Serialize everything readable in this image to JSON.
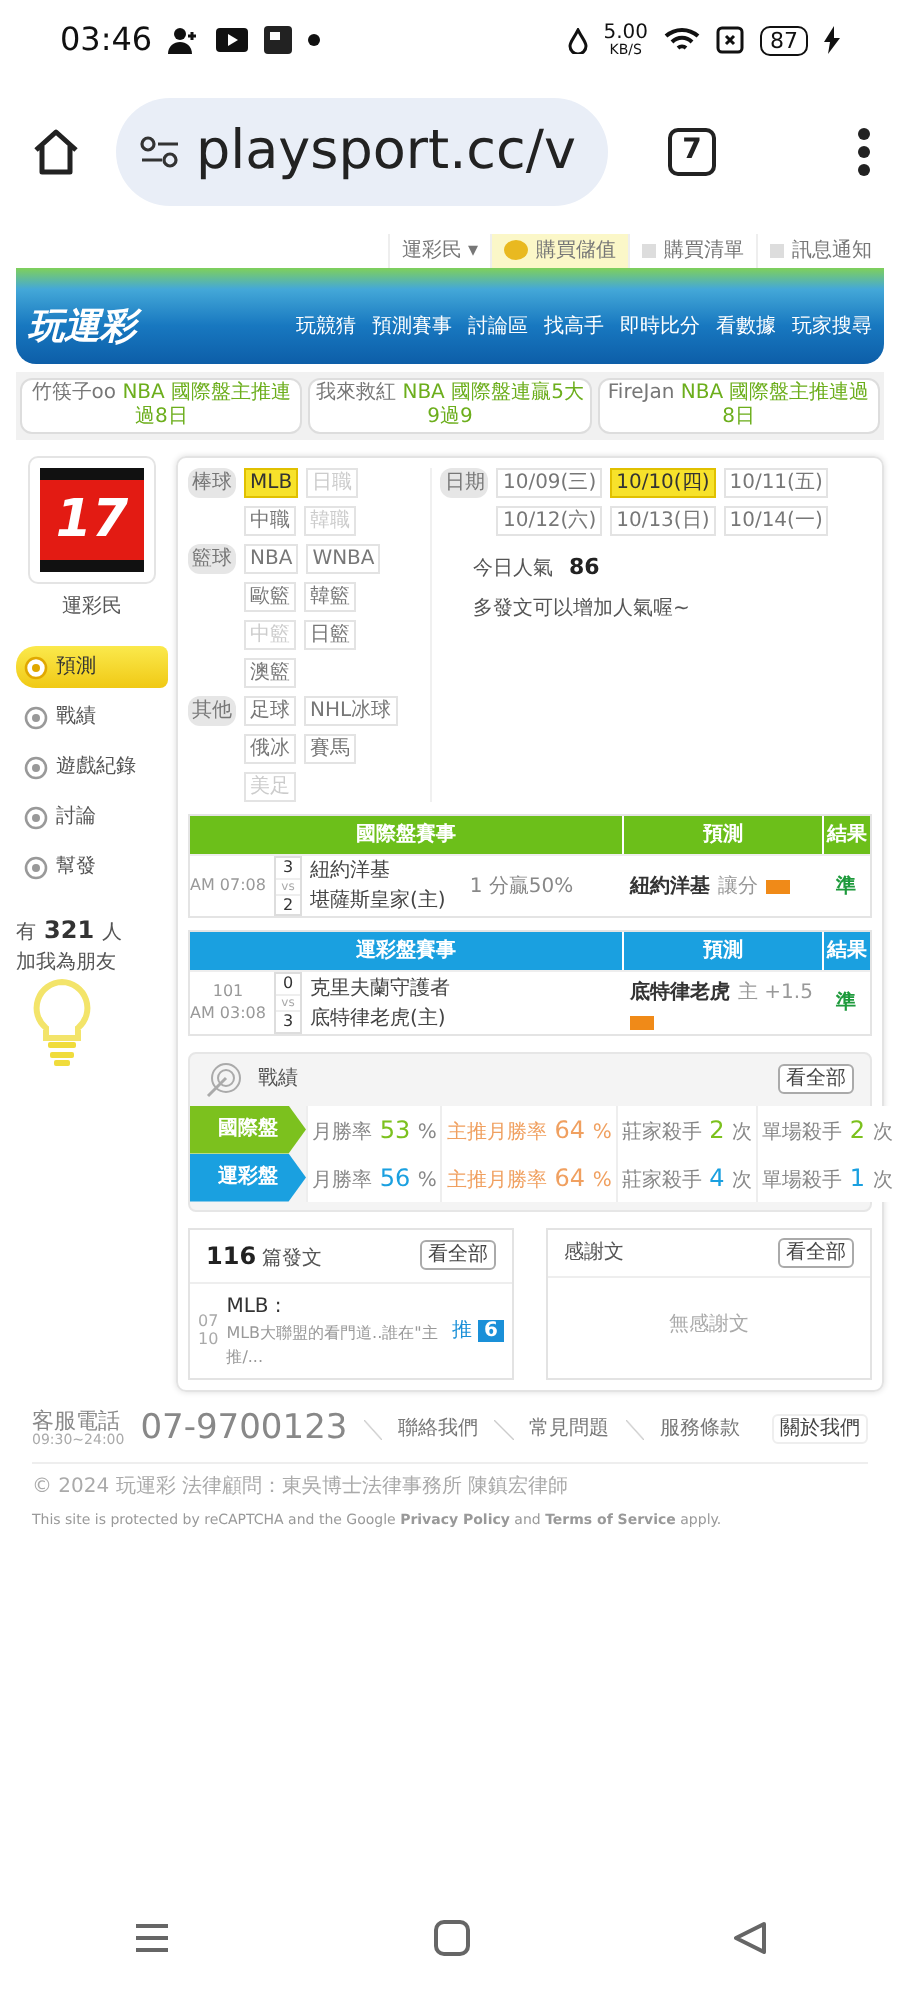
{
  "status_bar": {
    "time": "03:46",
    "net_speed": "5.00",
    "net_unit": "KB/S",
    "battery": "87"
  },
  "browser": {
    "url": "playsport.cc/v",
    "tab_count": "7"
  },
  "top_links": [
    {
      "label": "運彩民 ▾",
      "kind": "plain"
    },
    {
      "label": "購買儲值",
      "kind": "coin"
    },
    {
      "label": "購買清單",
      "kind": "small"
    },
    {
      "label": "訊息通知",
      "kind": "small"
    }
  ],
  "logo": "玩運彩",
  "nav": [
    "玩競猜",
    "預測賽事",
    "討論區",
    "找高手",
    "即時比分",
    "看數據",
    "玩家搜尋"
  ],
  "ticker": [
    {
      "user": "竹筷子oo",
      "text": "NBA 國際盤主推連過8日"
    },
    {
      "user": "我來救紅",
      "text": "NBA 國際盤連贏5大9過9"
    },
    {
      "user": "FireJan",
      "text": "NBA 國際盤主推連過8日"
    }
  ],
  "profile": {
    "avatar": "17",
    "name": "運彩民"
  },
  "menu": [
    {
      "label": "預測",
      "selected": true
    },
    {
      "label": "戰績",
      "selected": false
    },
    {
      "label": "遊戲紀錄",
      "selected": false
    },
    {
      "label": "討論",
      "selected": false
    },
    {
      "label": "幫發",
      "selected": false
    }
  ],
  "friends": {
    "prefix": "有",
    "count": "321",
    "suffix": "人",
    "note": "加我為朋友"
  },
  "filters": [
    {
      "label": "棒球",
      "options": [
        {
          "label": "MLB",
          "selected": true,
          "disabled": false
        },
        {
          "label": "日職",
          "selected": false,
          "disabled": true
        },
        {
          "label": "中職",
          "selected": false,
          "disabled": false
        },
        {
          "label": "韓職",
          "selected": false,
          "disabled": true
        }
      ]
    },
    {
      "label": "籃球",
      "options": [
        {
          "label": "NBA",
          "selected": false,
          "disabled": false
        },
        {
          "label": "WNBA",
          "selected": false,
          "disabled": false
        },
        {
          "label": "歐籃",
          "selected": false,
          "disabled": false
        },
        {
          "label": "韓籃",
          "selected": false,
          "disabled": false
        },
        {
          "label": "中籃",
          "selected": false,
          "disabled": true
        },
        {
          "label": "日籃",
          "selected": false,
          "disabled": false
        },
        {
          "label": "澳籃",
          "selected": false,
          "disabled": false
        }
      ]
    },
    {
      "label": "其他",
      "options": [
        {
          "label": "足球",
          "selected": false,
          "disabled": false
        },
        {
          "label": "NHL冰球",
          "selected": false,
          "disabled": false
        },
        {
          "label": "俄冰",
          "selected": false,
          "disabled": false
        },
        {
          "label": "賽馬",
          "selected": false,
          "disabled": false
        },
        {
          "label": "美足",
          "selected": false,
          "disabled": true
        }
      ]
    }
  ],
  "dates": {
    "label": "日期",
    "options": [
      {
        "label": "10/09(三)",
        "selected": false
      },
      {
        "label": "10/10(四)",
        "selected": true
      },
      {
        "label": "10/11(五)",
        "selected": false
      },
      {
        "label": "10/12(六)",
        "selected": false
      },
      {
        "label": "10/13(日)",
        "selected": false
      },
      {
        "label": "10/14(一)",
        "selected": false
      }
    ]
  },
  "popularity": {
    "label": "今日人氣",
    "value": "86",
    "tip": "多發文可以增加人氣喔~"
  },
  "games": [
    {
      "color": "#6cbf1a",
      "columns": [
        "國際盤賽事",
        "預測",
        "結果"
      ],
      "rows": [
        {
          "code": "",
          "time": "AM 07:08",
          "away_score": "3",
          "vs": "vs",
          "home_score": "2",
          "away": "紐約洋基",
          "home": "堪薩斯皇家(主)",
          "line": "1 分贏50%",
          "pick": "紐約洋基",
          "pick_note": "讓分",
          "result": "準"
        }
      ]
    },
    {
      "color": "#1aa0e0",
      "columns": [
        "運彩盤賽事",
        "預測",
        "結果"
      ],
      "rows": [
        {
          "code": "101",
          "time": "AM 03:08",
          "away_score": "0",
          "vs": "vs",
          "home_score": "3",
          "away": "克里夫蘭守護者",
          "home": "底特律老虎(主)",
          "line": "",
          "pick": "底特律老虎",
          "pick_note": "主 +1.5",
          "result": "準"
        }
      ]
    }
  ],
  "record": {
    "title": "戰績",
    "button": "看全部",
    "rows": [
      {
        "label": "國際盤",
        "color": "#7cc11e",
        "cells": [
          {
            "label": "月勝率",
            "value": "53",
            "unit": "%"
          },
          {
            "label": "主推月勝率",
            "value": "64",
            "unit": "%"
          },
          {
            "label": "莊家殺手",
            "value": "2",
            "unit": "次"
          },
          {
            "label": "單場殺手",
            "value": "2",
            "unit": "次"
          }
        ]
      },
      {
        "label": "運彩盤",
        "color": "#1aa0e0",
        "cells": [
          {
            "label": "月勝率",
            "value": "56",
            "unit": "%"
          },
          {
            "label": "主推月勝率",
            "value": "64",
            "unit": "%"
          },
          {
            "label": "莊家殺手",
            "value": "4",
            "unit": "次"
          },
          {
            "label": "單場殺手",
            "value": "1",
            "unit": "次"
          }
        ]
      }
    ]
  },
  "posts": {
    "count": "116",
    "label": "篇發文",
    "button": "看全部",
    "items": [
      {
        "day": "07",
        "month": "10",
        "tag": "MLB :",
        "title": "MLB大聯盟的看門道..誰在\"主推/...",
        "push_label": "推",
        "push": "6"
      }
    ]
  },
  "thanks": {
    "title": "感謝文",
    "button": "看全部",
    "empty": "無感謝文"
  },
  "footer": {
    "phone_label": "客服電話",
    "hours": "09:30~24:00",
    "phone": "07-9700123",
    "links": [
      "聯絡我們",
      "常見問題",
      "服務條款"
    ],
    "about": "關於我們",
    "copyright": "© 2024 玩運彩 法律顧問：東吳博士法律事務所 陳鎮宏律師",
    "recaptcha": "This site is protected by reCAPTCHA and the Google **Privacy Policy** and **Terms of Service** apply."
  }
}
